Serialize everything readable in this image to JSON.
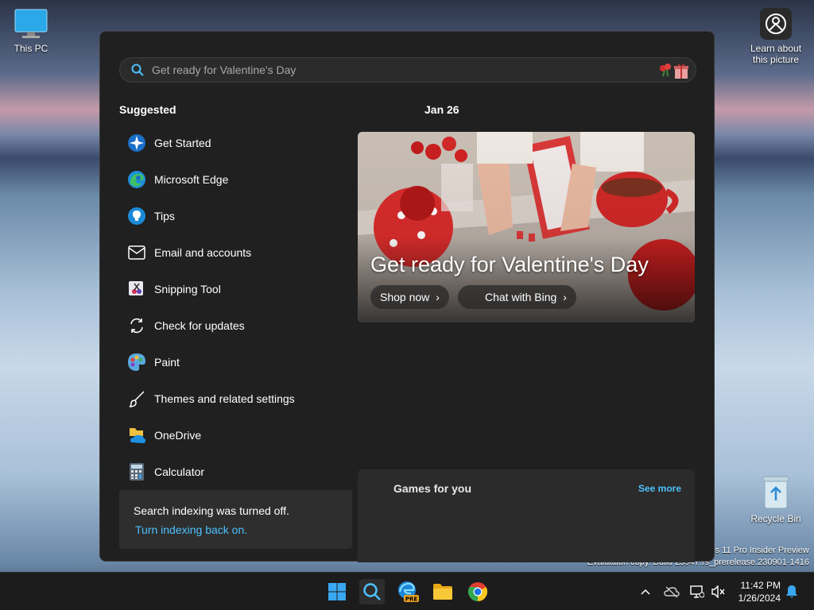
{
  "desktop": {
    "this_pc": "This PC",
    "learn_line1": "Learn about",
    "learn_line2": "this picture",
    "recycle_bin": "Recycle Bin",
    "watermark_line1": "s 11 Pro Insider Preview",
    "watermark_line2": "Evaluation copy. Build 25947.rs_prerelease.230901-1416"
  },
  "search": {
    "placeholder": "Get ready for Valentine's Day"
  },
  "suggested": {
    "title": "Suggested",
    "items": [
      {
        "label": "Get Started",
        "icon": "get-started-icon"
      },
      {
        "label": "Microsoft Edge",
        "icon": "edge-icon"
      },
      {
        "label": "Tips",
        "icon": "tips-icon"
      },
      {
        "label": "Email and accounts",
        "icon": "mail-icon"
      },
      {
        "label": "Snipping Tool",
        "icon": "snipping-tool-icon"
      },
      {
        "label": "Check for updates",
        "icon": "refresh-icon"
      },
      {
        "label": "Paint",
        "icon": "paint-icon"
      },
      {
        "label": "Themes and related settings",
        "icon": "brush-icon"
      },
      {
        "label": "OneDrive",
        "icon": "onedrive-icon"
      },
      {
        "label": "Calculator",
        "icon": "calculator-icon"
      }
    ]
  },
  "indexing": {
    "message": "Search indexing was turned off.",
    "link": "Turn indexing back on."
  },
  "today": {
    "date": "Jan 26",
    "hero_title": "Get ready for Valentine's Day",
    "shop_label": "Shop now",
    "bing_label": "Chat with Bing"
  },
  "games": {
    "title": "Games for you",
    "see_more": "See more"
  },
  "taskbar": {
    "time": "11:42 PM",
    "date": "1/26/2024",
    "pre_badge": "PRE"
  },
  "colors": {
    "panel_bg": "#202020",
    "accent_link": "#4cc2ff",
    "taskbar_bg": "#1c1c1c"
  }
}
